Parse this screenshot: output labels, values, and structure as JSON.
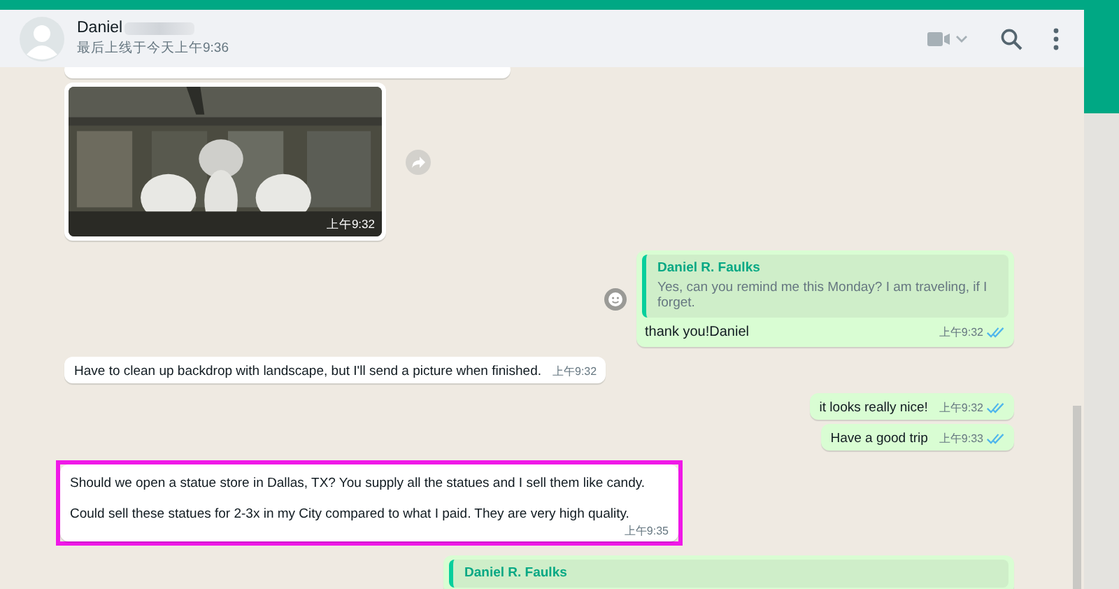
{
  "header": {
    "name": "Daniel",
    "status": "最后上线于今天上午9:36"
  },
  "messages": [
    {
      "kind": "in_cut"
    },
    {
      "kind": "in_image",
      "time": "上午9:32"
    },
    {
      "kind": "out_reply",
      "quote_author": "Daniel R. Faulks",
      "quote_text": "Yes, can you remind me this Monday? I am traveling, if I forget.",
      "text": "thank you!Daniel",
      "time": "上午9:32",
      "read": true
    },
    {
      "kind": "in_text",
      "paragraphs": [
        "Have to clean up backdrop with landscape, but I'll send a picture when finished."
      ],
      "time": "上午9:32",
      "highlighted": false
    },
    {
      "kind": "out_text",
      "paragraphs": [
        "it looks really nice!"
      ],
      "time": "上午9:32",
      "read": true,
      "highlighted": false
    },
    {
      "kind": "out_text",
      "paragraphs": [
        "Have a good trip"
      ],
      "time": "上午9:33",
      "read": true,
      "highlighted": false
    },
    {
      "kind": "in_text",
      "paragraphs": [
        "Should we open a statue store  in Dallas, TX? You supply all the statues and I sell them like candy.",
        "Could sell these statues for 2-3x in my City compared to what I paid. They are very high quality."
      ],
      "time": "上午9:35",
      "highlighted": true
    },
    {
      "kind": "out_reply_cut",
      "quote_author": "Daniel R. Faulks"
    }
  ]
}
